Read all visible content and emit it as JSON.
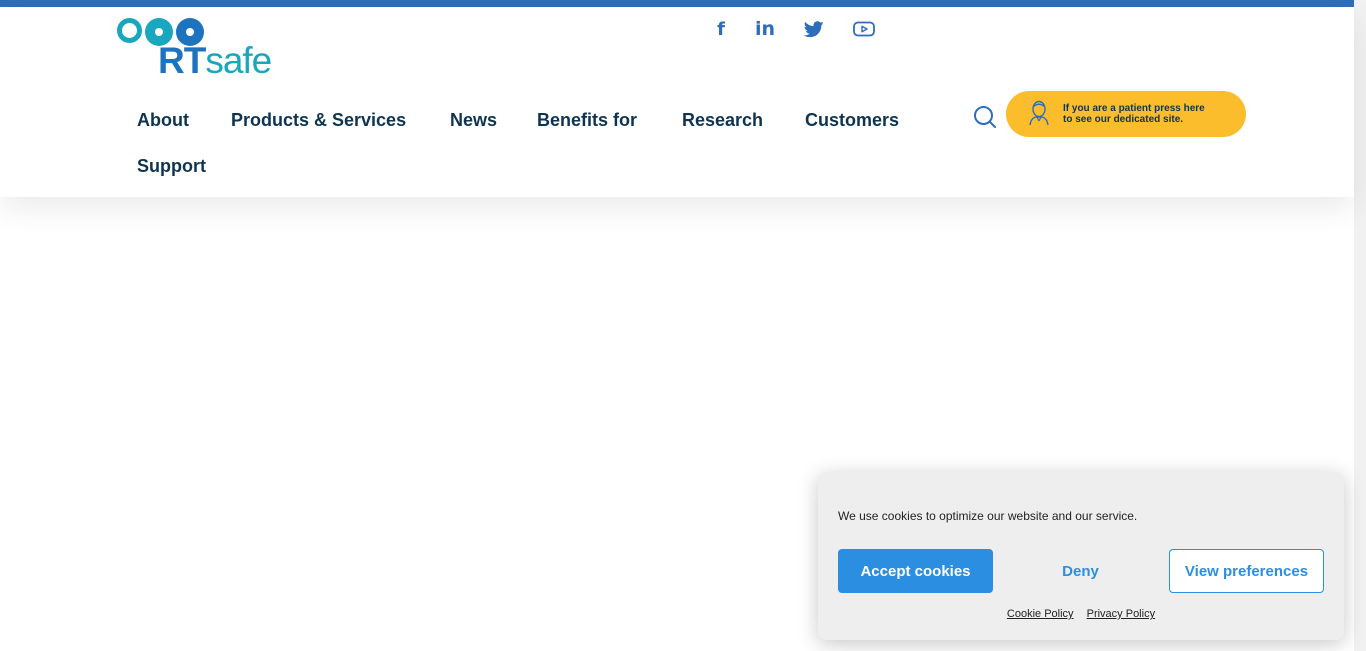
{
  "colors": {
    "top_bar": "#2d6dba",
    "nav_text": "#0e3452",
    "patient_button": "#fbbd2b",
    "cookie_accent": "#2c8ee0",
    "logo_blue": "#1d73bd",
    "logo_teal": "#18a7be"
  },
  "logo": {
    "brand_rt": "RT",
    "brand_safe": "safe"
  },
  "social": [
    {
      "name": "facebook-icon"
    },
    {
      "name": "linkedin-icon"
    },
    {
      "name": "twitter-icon"
    },
    {
      "name": "youtube-icon"
    }
  ],
  "nav": {
    "items": [
      "About",
      "Products & Services",
      "News",
      "Benefits for",
      "Research",
      "Customers",
      "Support"
    ]
  },
  "search": {
    "icon": "search-icon"
  },
  "patient": {
    "icon": "patient-icon",
    "line1": "If you are a patient press here",
    "line2": "to see our dedicated site."
  },
  "cookie": {
    "message": "We use cookies to optimize our website and our service.",
    "accept_label": "Accept cookies",
    "deny_label": "Deny",
    "preferences_label": "View preferences",
    "cookie_policy": "Cookie Policy",
    "privacy_policy": "Privacy Policy"
  }
}
